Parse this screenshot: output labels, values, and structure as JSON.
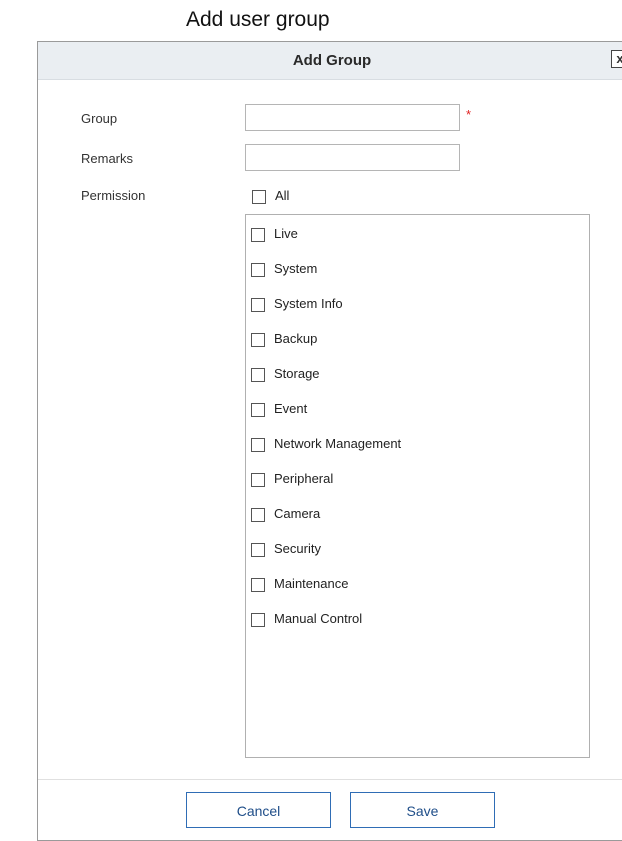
{
  "caption": "Add user group",
  "dialog": {
    "title": "Add Group",
    "close_label": "x"
  },
  "form": {
    "group_label": "Group",
    "group_value": "",
    "required_mark": "*",
    "remarks_label": "Remarks",
    "remarks_value": "",
    "permission_label": "Permission",
    "all_label": "All",
    "permissions": [
      {
        "label": "Live",
        "checked": false
      },
      {
        "label": "System",
        "checked": false
      },
      {
        "label": "System Info",
        "checked": false
      },
      {
        "label": "Backup",
        "checked": false
      },
      {
        "label": "Storage",
        "checked": false
      },
      {
        "label": "Event",
        "checked": false
      },
      {
        "label": "Network Management",
        "checked": false
      },
      {
        "label": "Peripheral",
        "checked": false
      },
      {
        "label": "Camera",
        "checked": false
      },
      {
        "label": "Security",
        "checked": false
      },
      {
        "label": "Maintenance",
        "checked": false
      },
      {
        "label": "Manual Control",
        "checked": false
      }
    ]
  },
  "footer": {
    "cancel_label": "Cancel",
    "save_label": "Save"
  },
  "colors": {
    "header_bg": "#eaeef2",
    "button_border": "#2f6db5",
    "button_text": "#1f4e89",
    "required": "#e02020"
  }
}
